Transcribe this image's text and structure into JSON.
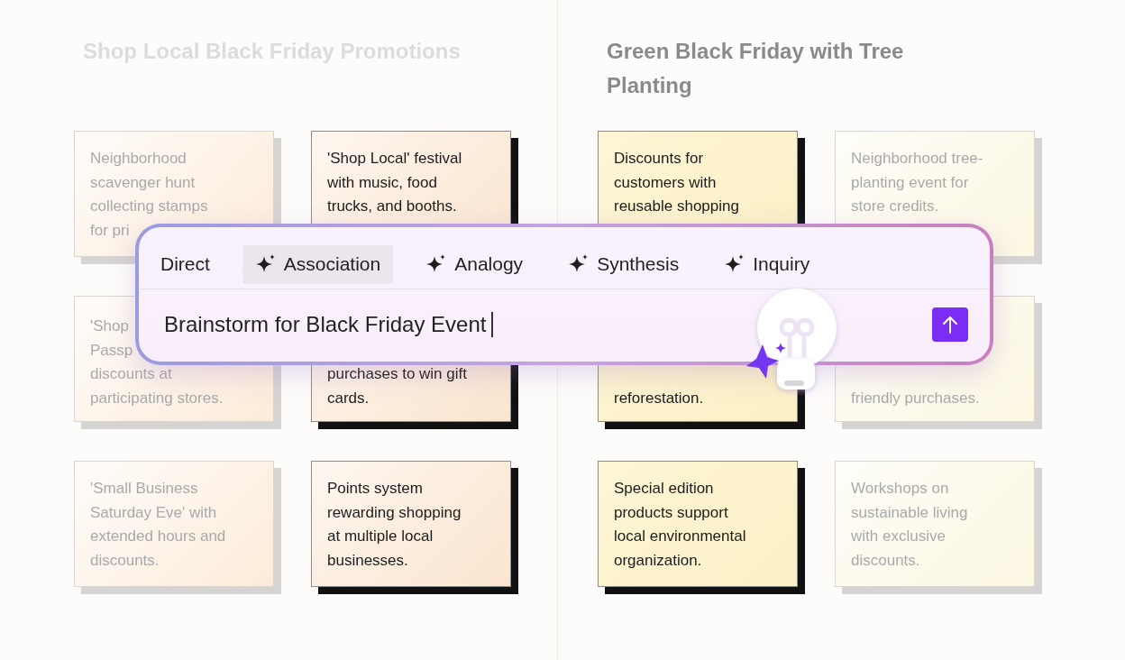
{
  "columns": [
    {
      "title": "Shop Local Black Friday Promotions",
      "faded": true,
      "cards": [
        {
          "lines": [
            "Neighborhood",
            "scavenger hunt",
            "collecting stamps",
            "for pri"
          ],
          "faded": true
        },
        {
          "lines": [
            "'Shop Local' festival",
            "with music, food",
            "trucks, and booths."
          ],
          "faded": false
        },
        {
          "lines": [
            "'Shop",
            "Passp",
            "discounts at",
            "participating stores."
          ],
          "faded": true
        },
        {
          "lines": [
            "purchases to win gift",
            "cards."
          ],
          "faded": false
        },
        {
          "lines": [
            "'Small Business",
            "Saturday Eve' with",
            "extended hours and",
            "discounts."
          ],
          "faded": true
        },
        {
          "lines": [
            "Points system",
            "rewarding shopping",
            "at multiple local",
            "businesses."
          ],
          "faded": false
        }
      ]
    },
    {
      "title": "Green Black Friday with Tree Planting",
      "faded": false,
      "cards": [
        {
          "lines": [
            "Discounts for",
            "customers with",
            "reusable shopping"
          ],
          "faded": false
        },
        {
          "lines": [
            "Neighborhood tree-",
            "planting event for",
            "store credits."
          ],
          "faded": true
        },
        {
          "lines": [
            "reforestation."
          ],
          "faded": false
        },
        {
          "lines": [
            "friendly purchases."
          ],
          "faded": true
        },
        {
          "lines": [
            "Special edition",
            "products support",
            "local environmental",
            "organization."
          ],
          "faded": false
        },
        {
          "lines": [
            "Workshops on",
            "sustainable living",
            "with exclusive",
            "discounts."
          ],
          "faded": true
        }
      ]
    }
  ],
  "prompt": {
    "modes": [
      {
        "label": "Direct",
        "kind": "plain",
        "selected": false
      },
      {
        "label": "Association",
        "kind": "sparkle",
        "selected": true
      },
      {
        "label": "Analogy",
        "kind": "sparkle",
        "selected": false
      },
      {
        "label": "Synthesis",
        "kind": "sparkle",
        "selected": false
      },
      {
        "label": "Inquiry",
        "kind": "sparkle",
        "selected": false
      }
    ],
    "value": "Brainstorm for Black Friday Event"
  }
}
